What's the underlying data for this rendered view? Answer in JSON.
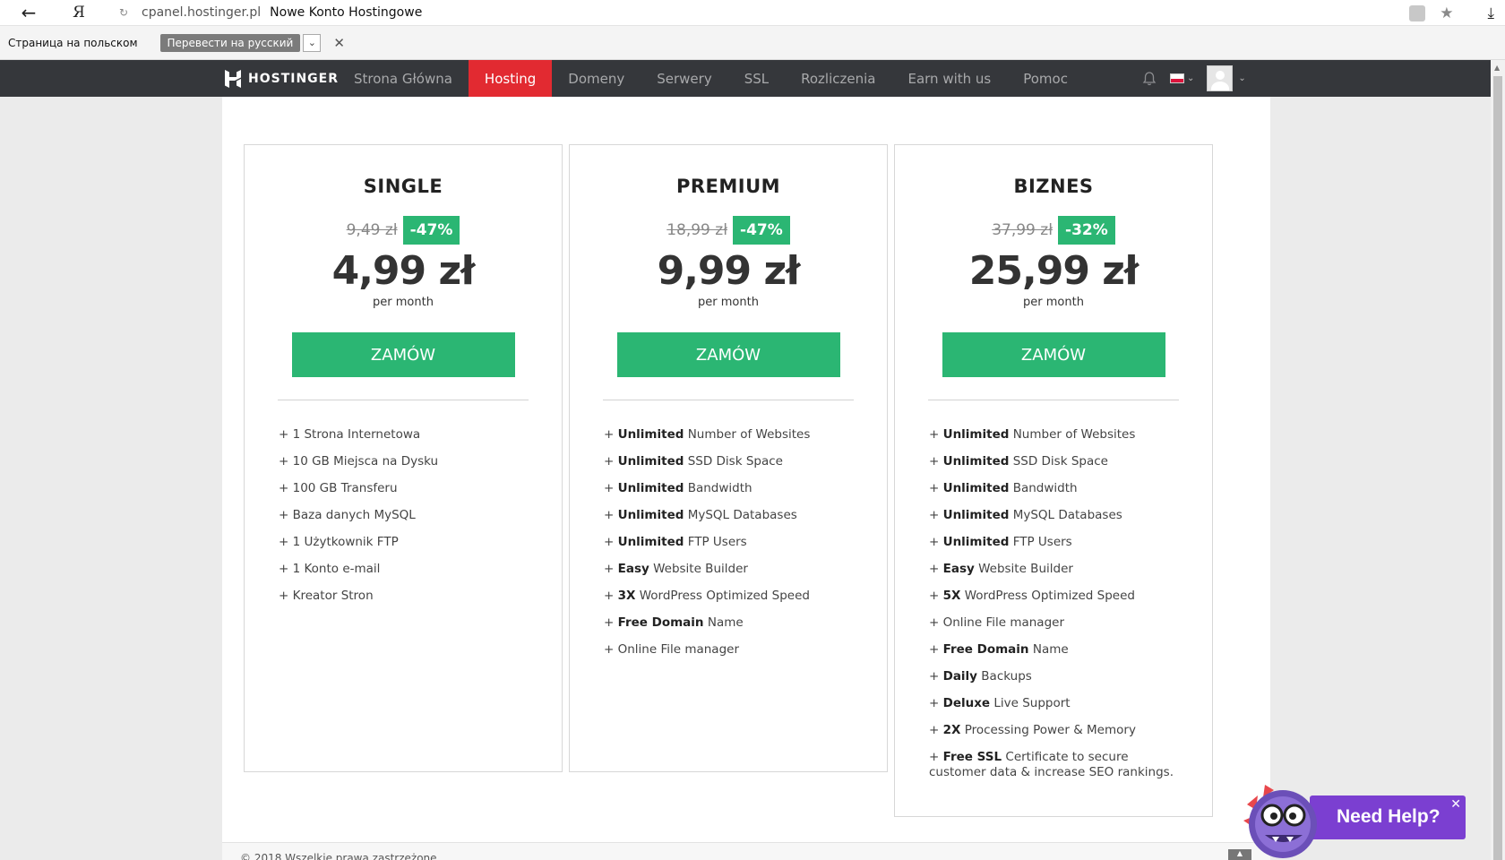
{
  "browser": {
    "back_icon": "back-arrow-icon",
    "ya": "Я",
    "host": "cpanel.hostinger.pl",
    "title": "Nowe Konto Hostingowe"
  },
  "translate": {
    "text": "Страница на польском",
    "button": "Перевести на русский",
    "dropdown": "⌄",
    "close": "✕"
  },
  "nav": {
    "logo": "HOSTINGER",
    "items": [
      "Strona Główna",
      "Hosting",
      "Domeny",
      "Serwery",
      "SSL",
      "Rozliczenia",
      "Earn with us",
      "Pomoc"
    ],
    "active": "Hosting"
  },
  "plans": [
    {
      "name": "SINGLE",
      "old_price": "9,49 zł",
      "discount": "-47%",
      "price": "4,99 zł",
      "period": "per month",
      "cta": "ZAMÓW",
      "features": [
        {
          "bold": "",
          "text": "1 Strona Internetowa"
        },
        {
          "bold": "",
          "text": "10 GB Miejsca na Dysku"
        },
        {
          "bold": "",
          "text": "100 GB Transferu"
        },
        {
          "bold": "",
          "text": "Baza danych MySQL"
        },
        {
          "bold": "",
          "text": "1 Użytkownik FTP"
        },
        {
          "bold": "",
          "text": "1 Konto e-mail"
        },
        {
          "bold": "",
          "text": "Kreator Stron"
        }
      ]
    },
    {
      "name": "PREMIUM",
      "old_price": "18,99 zł",
      "discount": "-47%",
      "price": "9,99 zł",
      "period": "per month",
      "cta": "ZAMÓW",
      "features": [
        {
          "bold": "Unlimited",
          "text": "Number of Websites"
        },
        {
          "bold": "Unlimited",
          "text": "SSD Disk Space"
        },
        {
          "bold": "Unlimited",
          "text": "Bandwidth"
        },
        {
          "bold": "Unlimited",
          "text": "MySQL Databases"
        },
        {
          "bold": "Unlimited",
          "text": "FTP Users"
        },
        {
          "bold": "Easy",
          "text": "Website Builder"
        },
        {
          "bold": "3X",
          "text": "WordPress Optimized Speed"
        },
        {
          "bold": "Free Domain",
          "text": "Name"
        },
        {
          "bold": "",
          "text": "Online File manager"
        }
      ]
    },
    {
      "name": "BIZNES",
      "old_price": "37,99 zł",
      "discount": "-32%",
      "price": "25,99 zł",
      "period": "per month",
      "cta": "ZAMÓW",
      "features": [
        {
          "bold": "Unlimited",
          "text": "Number of Websites"
        },
        {
          "bold": "Unlimited",
          "text": "SSD Disk Space"
        },
        {
          "bold": "Unlimited",
          "text": "Bandwidth"
        },
        {
          "bold": "Unlimited",
          "text": "MySQL Databases"
        },
        {
          "bold": "Unlimited",
          "text": "FTP Users"
        },
        {
          "bold": "Easy",
          "text": "Website Builder"
        },
        {
          "bold": "5X",
          "text": "WordPress Optimized Speed"
        },
        {
          "bold": "",
          "text": "Online File manager"
        },
        {
          "bold": "Free Domain",
          "text": "Name"
        },
        {
          "bold": "Daily",
          "text": "Backups"
        },
        {
          "bold": "Deluxe",
          "text": "Live Support"
        },
        {
          "bold": "2X",
          "text": "Processing Power & Memory"
        },
        {
          "bold": "Free SSL",
          "text": "Certificate to secure customer data & increase SEO rankings."
        }
      ]
    }
  ],
  "footer": "© 2018 Wszelkie prawa zastrzeżone",
  "help": {
    "text": "Need Help?",
    "close": "✕"
  },
  "colors": {
    "nav_bg": "#35373b",
    "active_red": "#e22a31",
    "green": "#2bb673",
    "help_purple": "#7b3fd1"
  }
}
